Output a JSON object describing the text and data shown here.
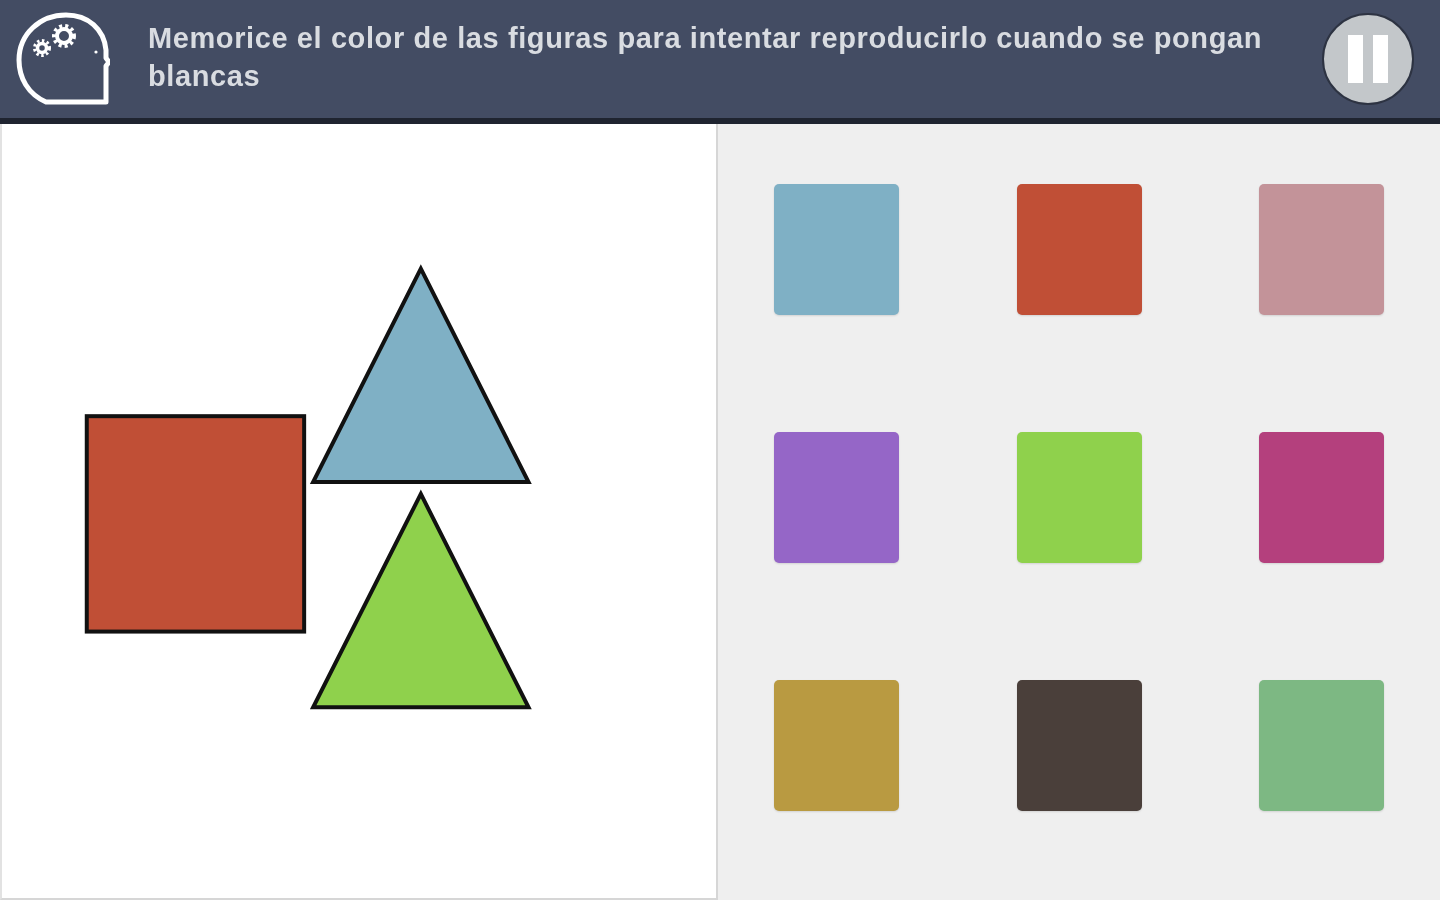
{
  "header": {
    "instruction": "Memorice el color de las figuras para intentar reproducirlo cuando se pongan blancas"
  },
  "figures": [
    {
      "kind": "square",
      "color": "#c04f36"
    },
    {
      "kind": "triangle",
      "color": "#7fb0c5"
    },
    {
      "kind": "triangle",
      "color": "#8fd14c"
    }
  ],
  "palette": [
    {
      "color": "#7fb0c5"
    },
    {
      "color": "#c04f36"
    },
    {
      "color": "#c39399"
    },
    {
      "color": "#9566c7"
    },
    {
      "color": "#8fd14c"
    },
    {
      "color": "#b4407d"
    },
    {
      "color": "#b99a41"
    },
    {
      "color": "#4a3f3a"
    },
    {
      "color": "#7db883"
    }
  ]
}
